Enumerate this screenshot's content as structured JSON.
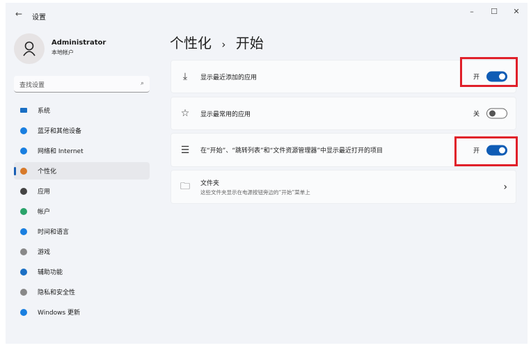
{
  "window": {
    "title": "设置",
    "back_icon": "back-arrow-icon",
    "minimize": "–",
    "maximize": "☐",
    "close": "✕"
  },
  "user": {
    "name": "Administrator",
    "type": "本地帐户"
  },
  "search": {
    "placeholder": "查找设置"
  },
  "nav": [
    {
      "label": "系统",
      "icon": "monitor-icon",
      "color": "#1a6fc4"
    },
    {
      "label": "蓝牙和其他设备",
      "icon": "bluetooth-icon",
      "color": "#1a7fe0"
    },
    {
      "label": "网络和 Internet",
      "icon": "wifi-icon",
      "color": "#1a7fe0"
    },
    {
      "label": "个性化",
      "icon": "brush-icon",
      "color": "#d87a2a",
      "selected": true
    },
    {
      "label": "应用",
      "icon": "apps-icon",
      "color": "#444"
    },
    {
      "label": "帐户",
      "icon": "person-icon",
      "color": "#2aa36a"
    },
    {
      "label": "时间和语言",
      "icon": "clock-globe-icon",
      "color": "#1a7fe0"
    },
    {
      "label": "游戏",
      "icon": "gamepad-icon",
      "color": "#888"
    },
    {
      "label": "辅助功能",
      "icon": "accessibility-icon",
      "color": "#1a6fc4"
    },
    {
      "label": "隐私和安全性",
      "icon": "shield-icon",
      "color": "#888"
    },
    {
      "label": "Windows 更新",
      "icon": "update-icon",
      "color": "#1a7fe0"
    }
  ],
  "breadcrumb": {
    "parent": "个性化",
    "sep": "›",
    "current": "开始"
  },
  "settings": [
    {
      "label": "显示最近添加的应用",
      "state": "开",
      "on": true,
      "icon": "download-icon"
    },
    {
      "label": "显示最常用的应用",
      "state": "关",
      "on": false,
      "icon": "star-icon"
    },
    {
      "label": "在“开始”、“跳转列表”和“文件资源管理器”中显示最近打开的项目",
      "state": "开",
      "on": true,
      "icon": "list-icon"
    },
    {
      "label": "文件夹",
      "sub": "这些文件夹显示在电源按钮旁边的“开始”菜单上",
      "icon": "folder-icon",
      "chevron": "›"
    }
  ]
}
